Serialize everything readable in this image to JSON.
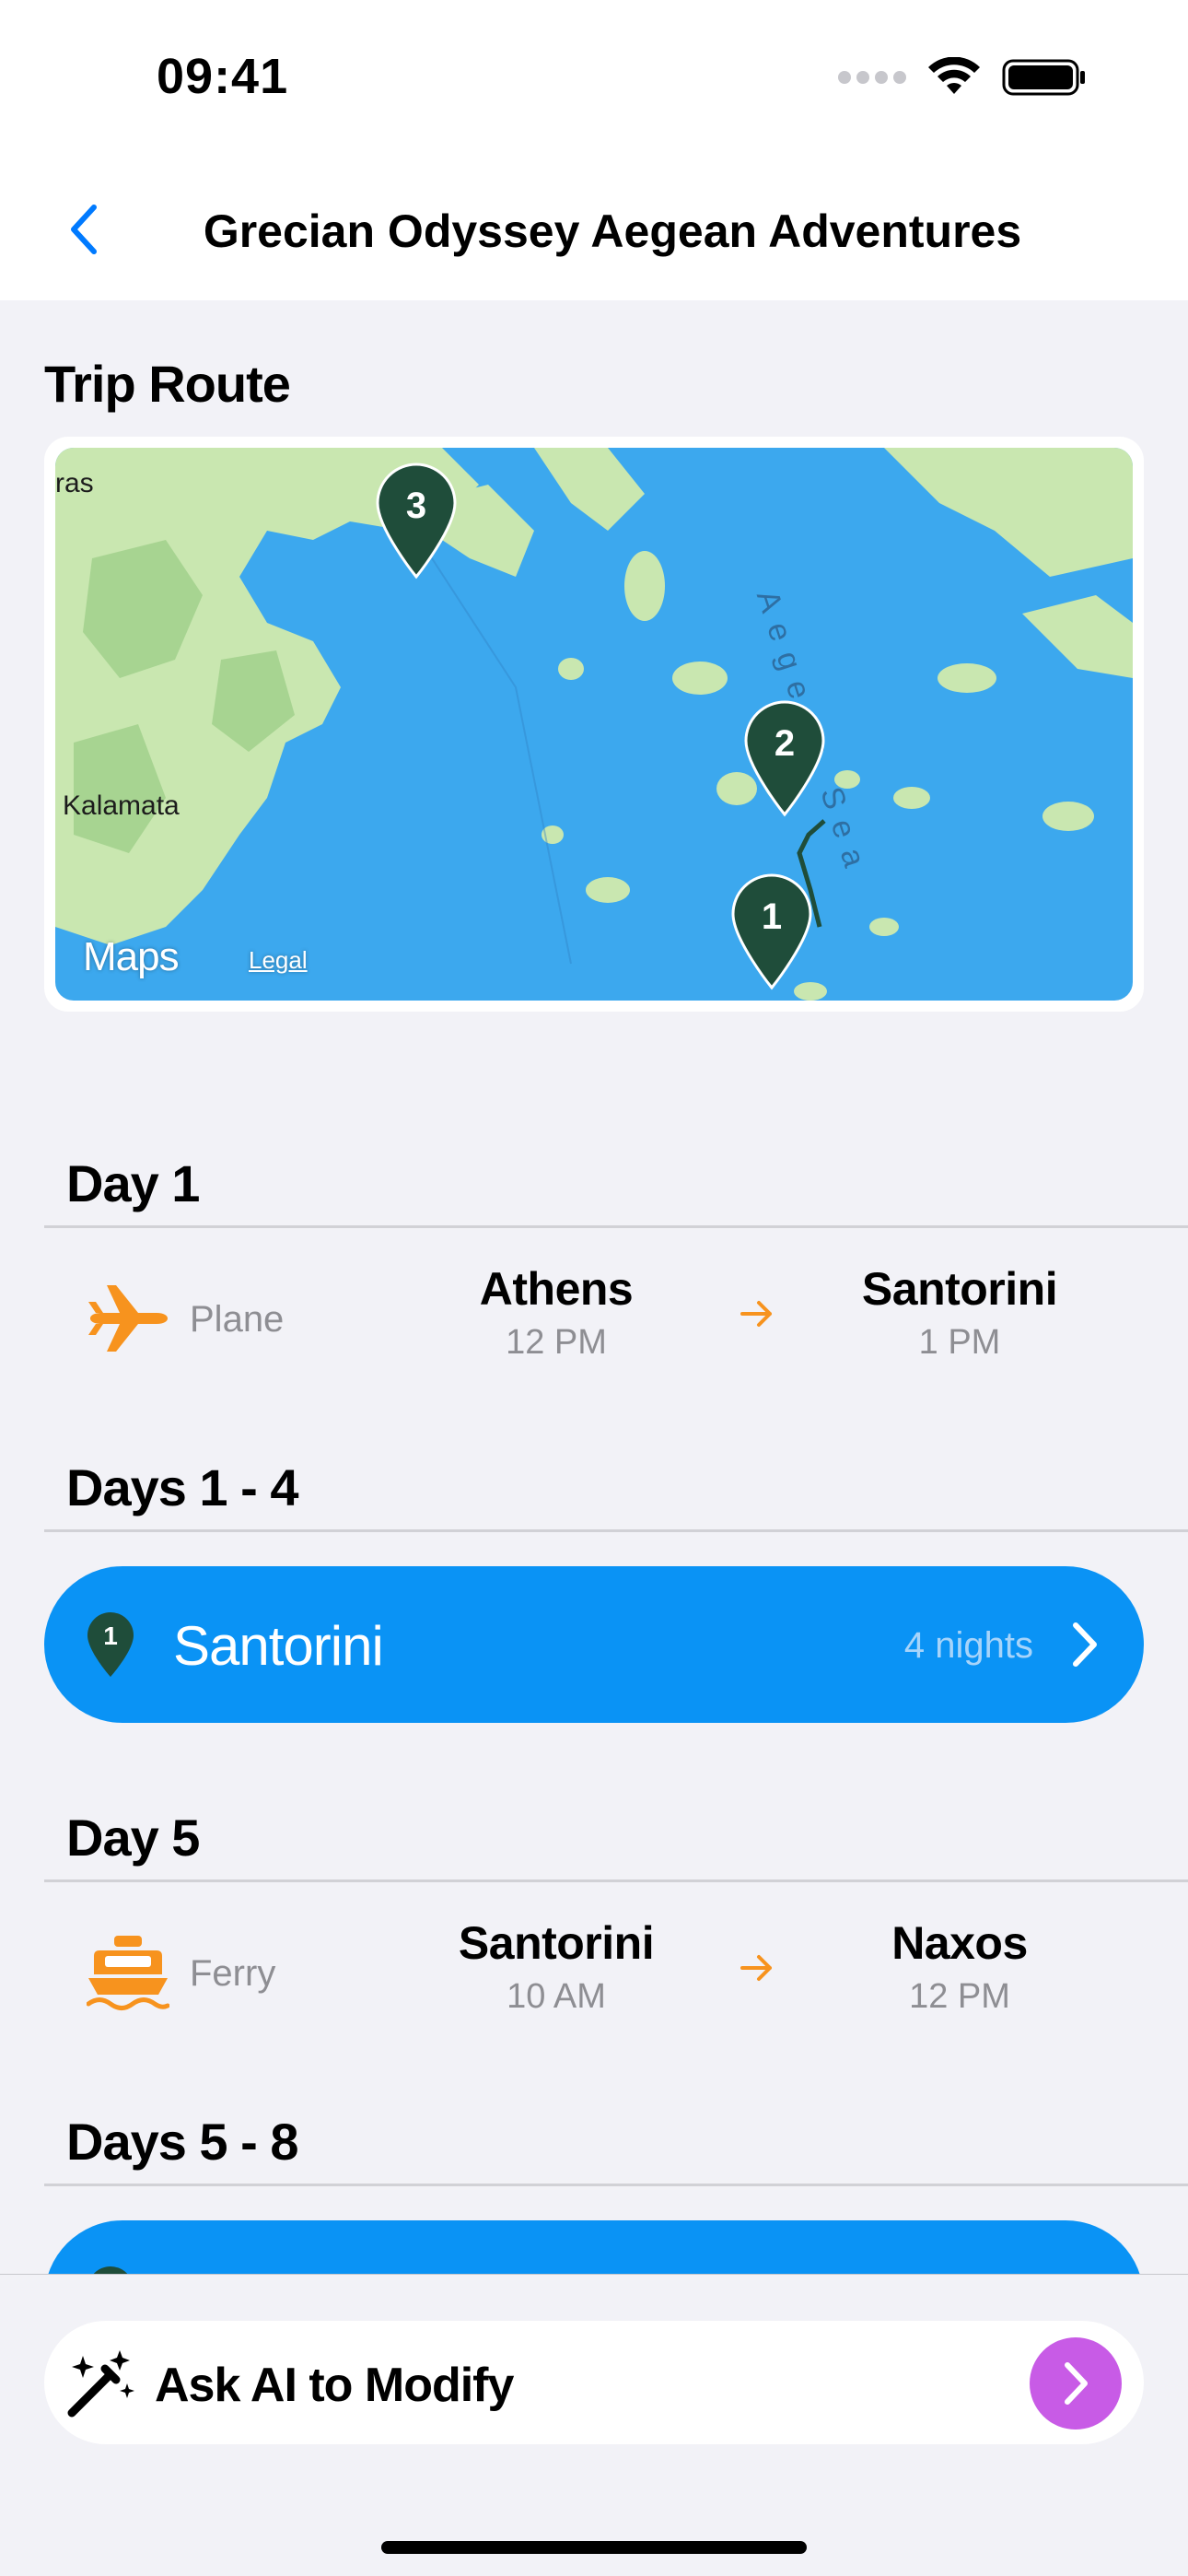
{
  "status_bar": {
    "time": "09:41"
  },
  "nav": {
    "title": "Grecian Odyssey Aegean Adventures"
  },
  "trip_route": {
    "title": "Trip Route",
    "map": {
      "labels": {
        "city_left": "ras",
        "kalamata": "Kalamata",
        "sea": "Aegean Sea"
      },
      "attribution": {
        "logo": "Maps",
        "legal": "Legal"
      },
      "pins": [
        "3",
        "2",
        "1"
      ]
    }
  },
  "itinerary": [
    {
      "header": "Day 1",
      "transport": {
        "type": "Plane",
        "icon": "plane-icon",
        "from_city": "Athens",
        "from_time": "12 PM",
        "to_city": "Santorini",
        "to_time": "1 PM"
      }
    },
    {
      "header": "Days 1 - 4",
      "stay": {
        "pin": "1",
        "city": "Santorini",
        "nights": "4 nights"
      }
    },
    {
      "header": "Day 5",
      "transport": {
        "type": "Ferry",
        "icon": "ferry-icon",
        "from_city": "Santorini",
        "from_time": "10 AM",
        "to_city": "Naxos",
        "to_time": "12 PM"
      }
    },
    {
      "header": "Days 5 - 8"
    }
  ],
  "ask_ai": {
    "label": "Ask AI to Modify"
  },
  "colors": {
    "accent_blue": "#0A93F5",
    "orange": "#F7931E",
    "pin_green": "#1F4D3A",
    "ai_purple": "#C85BE6",
    "back_blue": "#007AFF"
  }
}
